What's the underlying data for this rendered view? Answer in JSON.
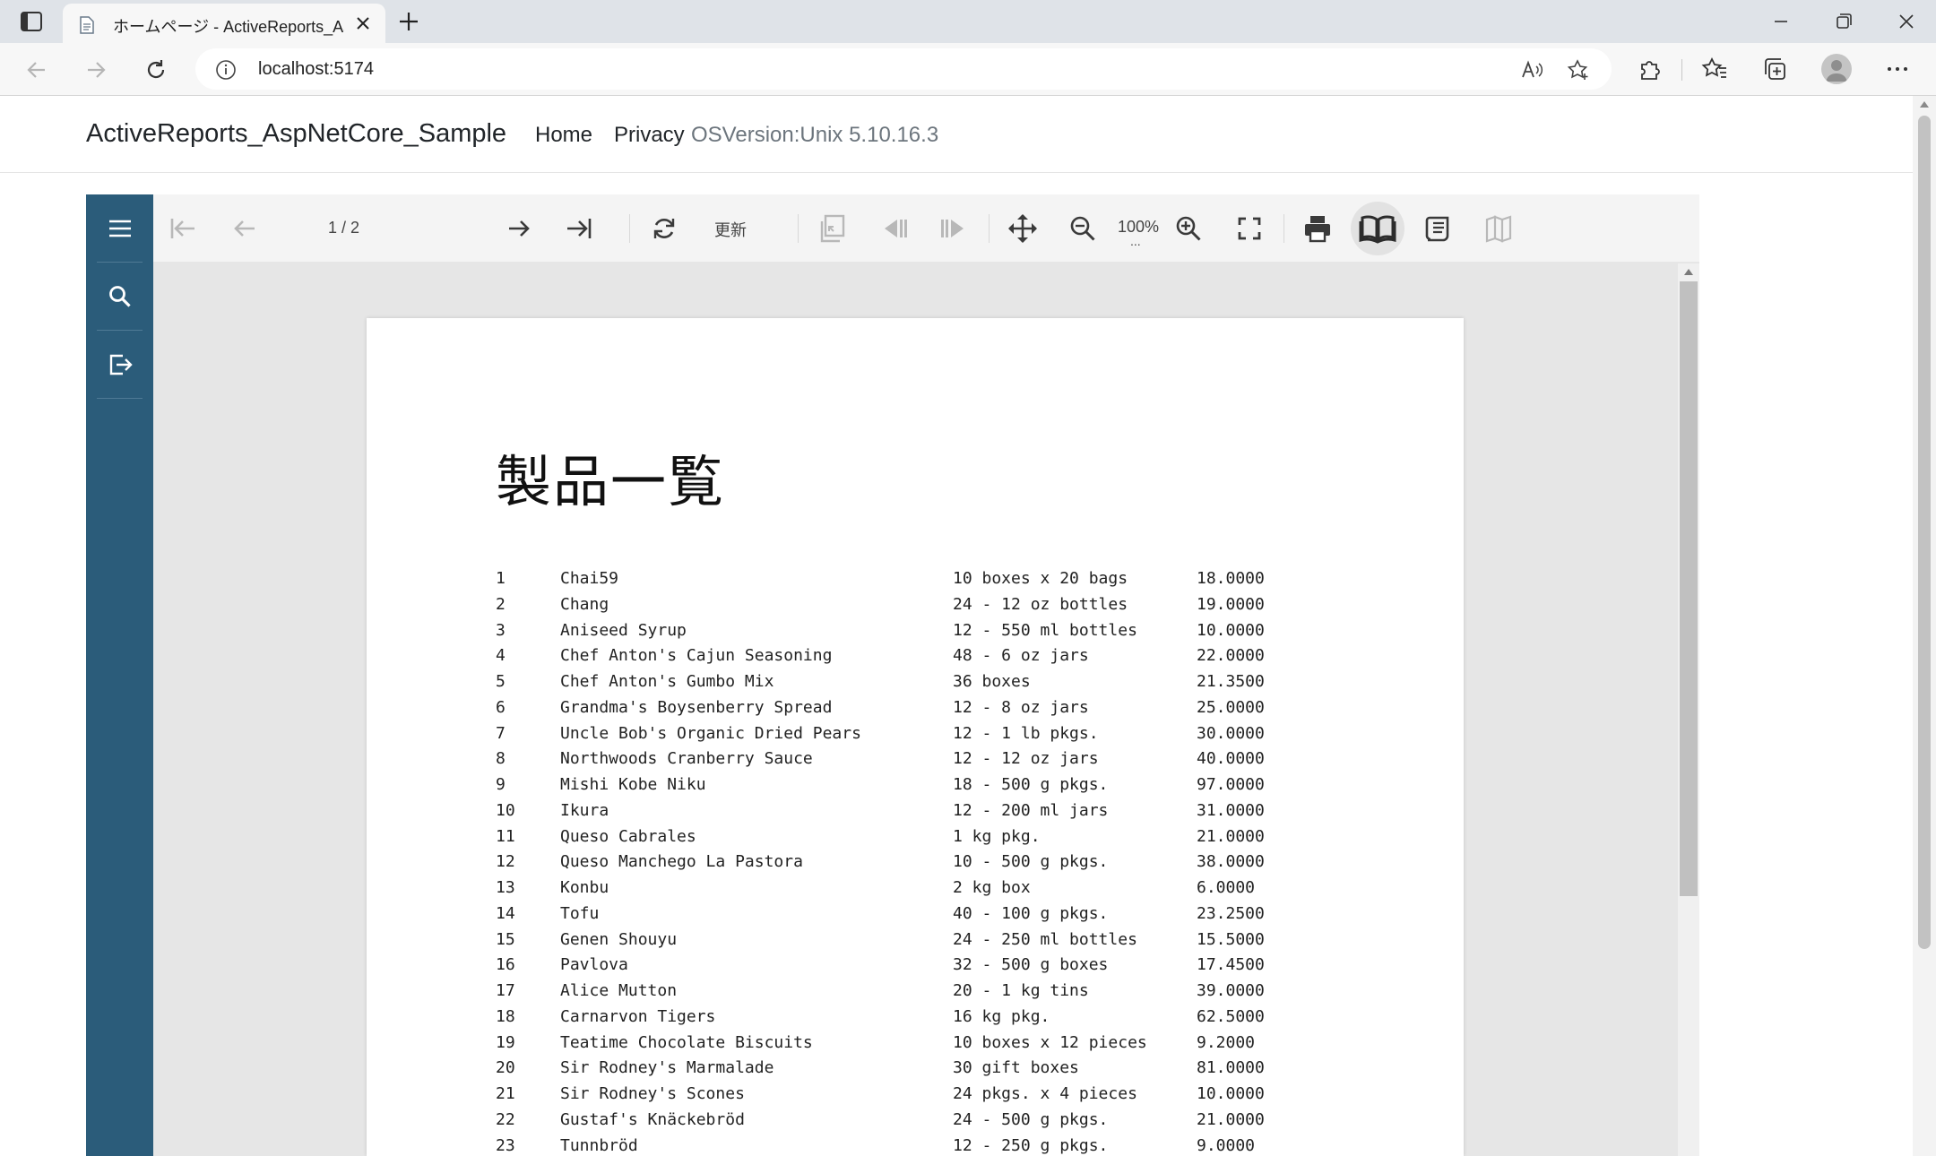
{
  "browser": {
    "tab_title": "ホームページ - ActiveReports_AspN",
    "url": "localhost:5174"
  },
  "site": {
    "brand": "ActiveReports_AspNetCore_Sample",
    "nav": [
      {
        "label": "Home"
      },
      {
        "label": "Privacy"
      }
    ],
    "os_version": "OSVersion:Unix 5.10.16.3"
  },
  "viewer": {
    "page_indicator": "1 / 2",
    "refresh_label": "更新",
    "zoom": "100%",
    "zoom_ellipsis": "..."
  },
  "report": {
    "title": "製品一覧",
    "rows": [
      {
        "id": "1",
        "name": "Chai59",
        "qty": "10 boxes x 20 bags",
        "price": "18.0000"
      },
      {
        "id": "2",
        "name": "Chang",
        "qty": "24 - 12 oz bottles",
        "price": "19.0000"
      },
      {
        "id": "3",
        "name": "Aniseed Syrup",
        "qty": "12 - 550 ml bottles",
        "price": "10.0000"
      },
      {
        "id": "4",
        "name": "Chef Anton's Cajun Seasoning",
        "qty": "48 - 6 oz jars",
        "price": "22.0000"
      },
      {
        "id": "5",
        "name": "Chef Anton's Gumbo Mix",
        "qty": "36 boxes",
        "price": "21.3500"
      },
      {
        "id": "6",
        "name": "Grandma's Boysenberry Spread",
        "qty": "12 - 8 oz jars",
        "price": "25.0000"
      },
      {
        "id": "7",
        "name": "Uncle Bob's Organic Dried Pears",
        "qty": "12 - 1 lb pkgs.",
        "price": "30.0000"
      },
      {
        "id": "8",
        "name": "Northwoods Cranberry Sauce",
        "qty": "12 - 12 oz jars",
        "price": "40.0000"
      },
      {
        "id": "9",
        "name": "Mishi Kobe Niku",
        "qty": "18 - 500 g pkgs.",
        "price": "97.0000"
      },
      {
        "id": "10",
        "name": "Ikura",
        "qty": "12 - 200 ml jars",
        "price": "31.0000"
      },
      {
        "id": "11",
        "name": "Queso Cabrales",
        "qty": "1 kg pkg.",
        "price": "21.0000"
      },
      {
        "id": "12",
        "name": "Queso Manchego La Pastora",
        "qty": "10 - 500 g pkgs.",
        "price": "38.0000"
      },
      {
        "id": "13",
        "name": "Konbu",
        "qty": "2 kg box",
        "price": "6.0000"
      },
      {
        "id": "14",
        "name": "Tofu",
        "qty": "40 - 100 g pkgs.",
        "price": "23.2500"
      },
      {
        "id": "15",
        "name": "Genen Shouyu",
        "qty": "24 - 250 ml bottles",
        "price": "15.5000"
      },
      {
        "id": "16",
        "name": "Pavlova",
        "qty": "32 - 500 g boxes",
        "price": "17.4500"
      },
      {
        "id": "17",
        "name": "Alice Mutton",
        "qty": "20 - 1 kg tins",
        "price": "39.0000"
      },
      {
        "id": "18",
        "name": "Carnarvon Tigers",
        "qty": "16 kg pkg.",
        "price": "62.5000"
      },
      {
        "id": "19",
        "name": "Teatime Chocolate Biscuits",
        "qty": "10 boxes x 12 pieces",
        "price": "9.2000"
      },
      {
        "id": "20",
        "name": "Sir Rodney's Marmalade",
        "qty": "30 gift boxes",
        "price": "81.0000"
      },
      {
        "id": "21",
        "name": "Sir Rodney's Scones",
        "qty": "24 pkgs. x 4 pieces",
        "price": "10.0000"
      },
      {
        "id": "22",
        "name": "Gustaf's Knäckebröd",
        "qty": "24 - 500 g pkgs.",
        "price": "21.0000"
      },
      {
        "id": "23",
        "name": "Tunnbröd",
        "qty": "12 - 250 g pkgs.",
        "price": "9.0000"
      }
    ]
  },
  "colors": {
    "sidebar": "#2b5c7a",
    "toolbar": "#f4f4f4",
    "viewer_bg": "#e6e6e6"
  }
}
